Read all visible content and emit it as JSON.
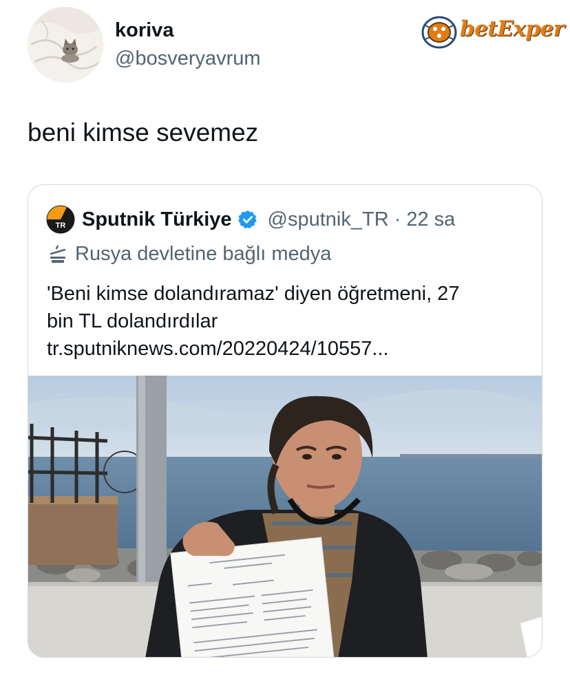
{
  "author": {
    "display_name": "koriva",
    "handle": "@bosveryavrum",
    "avatar_icon": "cat-on-blanket-avatar"
  },
  "watermark": {
    "brand": "betExper",
    "icon": "dice-icon"
  },
  "tweet": {
    "text": "beni kimse sevemez"
  },
  "quoted": {
    "name": "Sputnik Türkiye",
    "handle": "@sputnik_TR",
    "separator": "·",
    "time": "22 sa",
    "logo_icon": "sputnik-logo-icon",
    "logo_text": "TR",
    "verified_icon": "verified-badge-icon",
    "label_icon": "state-affiliated-media-icon",
    "label": "Rusya devletine bağlı medya",
    "line1": "'Beni kimse dolandıramaz' diyen öğretmeni, 27",
    "line2": "bin TL dolandırdılar",
    "link": "tr.sputniknews.com/20220424/10557...",
    "photo_icon": "woman-holding-document-photo"
  },
  "colors": {
    "text_primary": "#0f1419",
    "text_secondary": "#536471",
    "border": "#cfd9de",
    "verified_blue": "#1d9bf0",
    "watermark_orange": "#e07d18"
  }
}
